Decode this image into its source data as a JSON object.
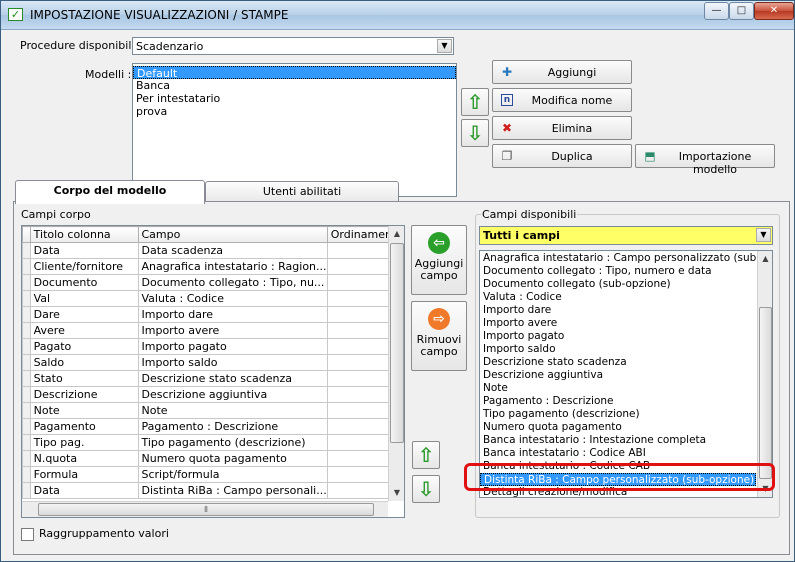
{
  "window": {
    "title": "IMPOSTAZIONE VISUALIZZAZIONI / STAMPE",
    "min_glyph": "—",
    "max_glyph": "□",
    "close_glyph": "✕"
  },
  "top": {
    "procedure_label": "Procedure disponibili :",
    "procedure_value": "Scadenzario",
    "models_label": "Modelli :",
    "models": [
      "Default",
      "Banca",
      "Per intestatario",
      "prova"
    ],
    "selected_model": "Default",
    "buttons": {
      "add": "Aggiungi",
      "rename": "Modifica nome",
      "delete": "Elimina",
      "duplicate": "Duplica",
      "import": "Importazione modello"
    }
  },
  "tabs": [
    {
      "label": "Corpo del modello",
      "active": true
    },
    {
      "label": "Utenti abilitati",
      "active": false
    }
  ],
  "body_fields": {
    "label": "Campi corpo",
    "columns": [
      "Titolo colonna",
      "Campo",
      "Ordinamento"
    ],
    "rows": [
      [
        "Data",
        "Data scadenza",
        ""
      ],
      [
        "Cliente/fornitore",
        "Anagrafica intestatario : Ragion...",
        ""
      ],
      [
        "Documento",
        "Documento collegato : Tipo, nu...",
        ""
      ],
      [
        "Val",
        "Valuta : Codice",
        ""
      ],
      [
        "Dare",
        "Importo dare",
        ""
      ],
      [
        "Avere",
        "Importo avere",
        ""
      ],
      [
        "Pagato",
        "Importo pagato",
        ""
      ],
      [
        "Saldo",
        "Importo saldo",
        ""
      ],
      [
        "Stato",
        "Descrizione stato scadenza",
        ""
      ],
      [
        "Descrizione",
        "Descrizione aggiuntiva",
        ""
      ],
      [
        "Note",
        "Note",
        ""
      ],
      [
        "Pagamento",
        "Pagamento : Descrizione",
        ""
      ],
      [
        "Tipo pag.",
        "Tipo pagamento (descrizione)",
        ""
      ],
      [
        "N.quota",
        "Numero quota pagamento",
        ""
      ],
      [
        "Formula",
        "Script/formula",
        ""
      ],
      [
        "Data",
        "Distinta RiBa : Campo personali...",
        ""
      ]
    ]
  },
  "side_buttons": {
    "add_field": "Aggiungi campo",
    "remove_field": "Rimuovi campo"
  },
  "available_fields": {
    "label": "Campi disponibili",
    "filter_value": "Tutti i campi",
    "items": [
      "Anagrafica intestatario : Campo personalizzato (sub-opzione)",
      "Documento collegato : Tipo, numero e data",
      "Documento collegato (sub-opzione)",
      "Valuta : Codice",
      "Importo dare",
      "Importo avere",
      "Importo pagato",
      "Importo saldo",
      "Descrizione stato scadenza",
      "Descrizione aggiuntiva",
      "Note",
      "Pagamento : Descrizione",
      "Tipo pagamento (descrizione)",
      "Numero quota pagamento",
      "Banca intestatario : Intestazione completa",
      "Banca intestatario : Codice ABI",
      "Banca intestatario : Codice CAB",
      "Distinta RiBa : Campo personalizzato (sub-opzione) - Distinta",
      "Dettagli creazione/modifica"
    ],
    "selected_item": "Distinta RiBa : Campo personalizzato (sub-opzione) - Distinta"
  },
  "grouping_label": "Raggruppamento valori",
  "colors": {
    "filter_bg": "#ffff66",
    "selection": "#3399ff",
    "highlight_box": "#e01010"
  }
}
